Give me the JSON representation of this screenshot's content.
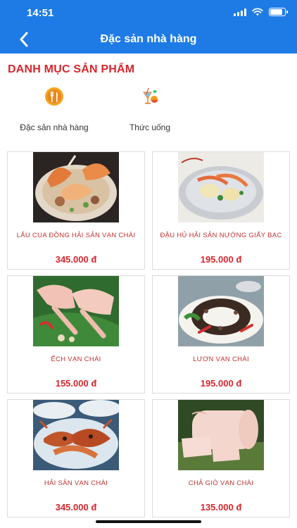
{
  "status_bar": {
    "time": "14:51",
    "battery_level": 0.85
  },
  "nav": {
    "title": "Đặc sản nhà hàng",
    "back_icon": "chevron-left-icon"
  },
  "section": {
    "title": "DANH MỤC SẢN PHẨM"
  },
  "categories": [
    {
      "label": "Đặc sản nhà hàng",
      "icon": "restaurant-icon"
    },
    {
      "label": "Thức uống",
      "icon": "drinks-icon"
    }
  ],
  "products": [
    {
      "name": "LẨU CUA ĐỒNG HẢI SẢN VẠN CHÀI",
      "price": "345.000 đ"
    },
    {
      "name": "ĐẬU HỦ HẢI SẢN NƯỚNG GIẤY BẠC",
      "price": "195.000 đ"
    },
    {
      "name": "ẾCH VẠN CHÀI",
      "price": "155.000 đ"
    },
    {
      "name": "LƯƠN VẠN CHÀI",
      "price": "195.000 đ"
    },
    {
      "name": "HẢI SẢN VẠN CHÀI",
      "price": "345.000 đ"
    },
    {
      "name": "CHẢ GIÒ VẠN CHÀI",
      "price": "135.000 đ"
    }
  ],
  "colors": {
    "primary": "#1e7be6",
    "accent_red": "#d6262c"
  }
}
